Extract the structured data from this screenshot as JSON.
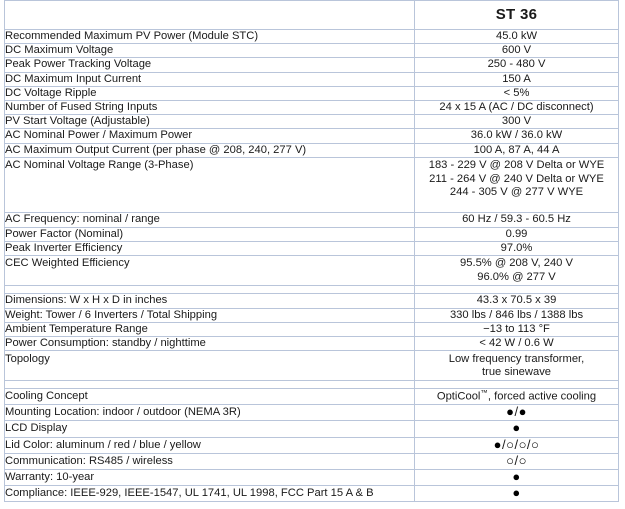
{
  "table": {
    "header": {
      "label_column": "",
      "value_column": "ST 36"
    },
    "line_color": "#b9c5da",
    "text_color": "#1a1a1a",
    "symbols": {
      "filled": "●",
      "hollow": "○",
      "separator": "/"
    },
    "sections": [
      {
        "name": "dc-input",
        "rows": [
          {
            "label": "Recommended Maximum PV Power (Module STC)",
            "value": "45.0 kW"
          },
          {
            "label": "DC Maximum Voltage",
            "value": "600 V"
          },
          {
            "label": "Peak Power Tracking Voltage",
            "value": "250 - 480 V"
          },
          {
            "label": "DC Maximum Input Current",
            "value": "150 A"
          },
          {
            "label": "DC Voltage Ripple",
            "value": "< 5%"
          },
          {
            "label": "Number of Fused String Inputs",
            "value": "24 x 15 A  (AC / DC disconnect)"
          },
          {
            "label": "PV Start Voltage (Adjustable)",
            "value": "300 V"
          },
          {
            "label": "AC Nominal Power / Maximum Power",
            "value": "36.0 kW / 36.0 kW"
          },
          {
            "label": "AC Maximum Output Current (per phase @ 208, 240, 277 V)",
            "value": "100 A, 87 A, 44 A"
          },
          {
            "label": "AC Nominal Voltage Range (3-Phase)",
            "value_lines": [
              "183 - 229 V @ 208 V Delta or WYE",
              "211 - 264 V @ 240 V Delta or WYE",
              "244 - 305 V @ 277 V WYE"
            ]
          },
          {
            "label": "AC Frequency: nominal / range",
            "value": "60 Hz  / 59.3 - 60.5 Hz"
          },
          {
            "label": "Power Factor (Nominal)",
            "value": "0.99"
          },
          {
            "label": "Peak Inverter Efficiency",
            "value": "97.0%"
          },
          {
            "label": "CEC Weighted Efficiency",
            "value_lines": [
              "95.5% @ 208 V, 240 V",
              "96.0% @ 277 V"
            ]
          }
        ]
      },
      {
        "name": "mechanical",
        "rows": [
          {
            "label": "Dimensions: W x H x D in inches",
            "value": "43.3  x  70.5  x 39"
          },
          {
            "label": "Weight: Tower / 6 Inverters / Total Shipping",
            "value": "330 lbs / 846 lbs / 1388 lbs"
          },
          {
            "label": "Ambient Temperature Range",
            "value": "−13 to 113 °F"
          },
          {
            "label": "Power Consumption: standby / nighttime",
            "value": "< 42 W / 0.6 W"
          },
          {
            "label": "Topology",
            "value_lines": [
              "Low frequency transformer,",
              "true sinewave"
            ]
          }
        ]
      },
      {
        "name": "features",
        "rows": [
          {
            "label": "Cooling Concept",
            "value_html": "OptiCool<tm>™</tm>, forced active cooling",
            "value": "OptiCool™, forced active cooling"
          },
          {
            "label": "Mounting Location: indoor / outdoor (NEMA 3R)",
            "dots": [
              "filled",
              "filled"
            ]
          },
          {
            "label": "LCD Display",
            "dots": [
              "filled"
            ]
          },
          {
            "label": "Lid Color: aluminum / red / blue / yellow",
            "dots": [
              "filled",
              "hollow",
              "hollow",
              "hollow"
            ]
          },
          {
            "label": "Communication: RS485 / wireless",
            "dots": [
              "hollow",
              "hollow"
            ]
          },
          {
            "label": "Warranty: 10-year",
            "dots": [
              "filled"
            ]
          },
          {
            "label": "Compliance: IEEE-929, IEEE-1547, UL 1741, UL 1998, FCC Part 15 A & B",
            "dots": [
              "filled"
            ]
          }
        ]
      }
    ]
  }
}
